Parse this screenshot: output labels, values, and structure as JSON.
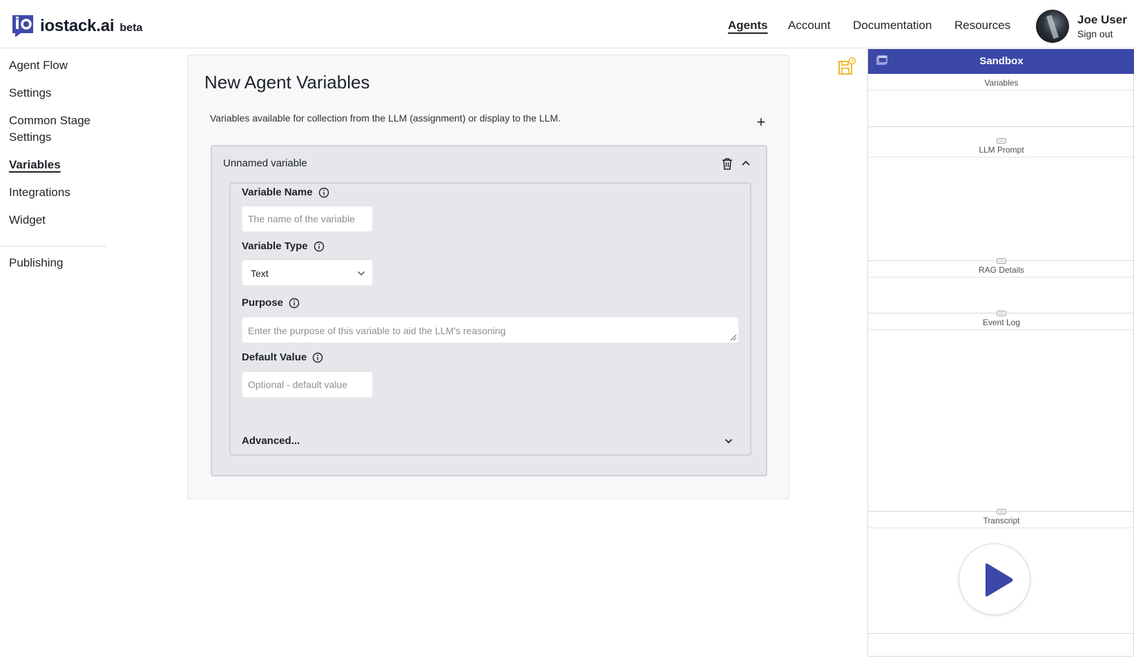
{
  "brand": {
    "name": "iostack.ai",
    "badge": "beta"
  },
  "topnav": [
    {
      "label": "Agents",
      "active": true
    },
    {
      "label": "Account",
      "active": false
    },
    {
      "label": "Documentation",
      "active": false
    },
    {
      "label": "Resources",
      "active": false
    }
  ],
  "user": {
    "name": "Joe User",
    "signout": "Sign out"
  },
  "sidebar": {
    "items": [
      {
        "label": "Agent Flow"
      },
      {
        "label": "Settings"
      },
      {
        "label": "Common Stage Settings"
      },
      {
        "label": "Variables",
        "active": true
      },
      {
        "label": "Integrations"
      },
      {
        "label": "Widget"
      },
      {
        "label": "Publishing"
      }
    ]
  },
  "main": {
    "title": "New Agent Variables",
    "description": "Variables available for collection from the LLM (assignment) or display to the LLM.",
    "add_label": "+",
    "variable": {
      "title": "Unnamed variable",
      "name_label": "Variable Name",
      "name_placeholder": "The name of the variable",
      "type_label": "Variable Type",
      "type_value": "Text",
      "purpose_label": "Purpose",
      "purpose_placeholder": "Enter the purpose of this variable to aid the LLM's reasoning",
      "default_label": "Default Value",
      "default_placeholder": "Optional - default value",
      "advanced_label": "Advanced..."
    }
  },
  "sandbox": {
    "title": "Sandbox",
    "sections": [
      "Variables",
      "LLM Prompt",
      "RAG Details",
      "Event Log",
      "Transcript"
    ]
  },
  "colors": {
    "accent": "#3b48a8",
    "save_icon": "#f1b82d",
    "panel_bg": "#e6e7ea"
  }
}
